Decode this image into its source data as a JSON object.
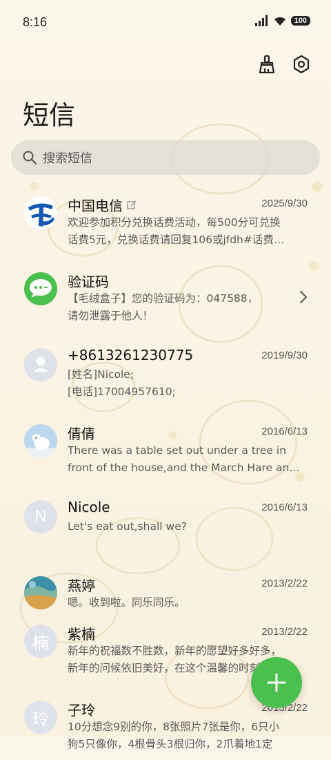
{
  "status": {
    "time": "8:16",
    "battery": "100"
  },
  "header": {
    "title": "短信"
  },
  "search": {
    "placeholder": "搜索短信"
  },
  "conversations": [
    {
      "name": "中国电信",
      "date": "2025/9/30",
      "line1": "欢迎参加积分兑换话费活动，每500分可兑换",
      "line2": "话费5元，兑换话费请回复106或jfdh#话费…"
    },
    {
      "name": "验证码",
      "date": "",
      "line1": "【毛绒盒子】您的验证码为：047588，",
      "line2": "请勿泄露于他人！"
    },
    {
      "name": "+8613261230775",
      "date": "2019/9/30",
      "line1": "[姓名]Nicole;",
      "line2": "[电话]17004957610;"
    },
    {
      "name": "倩倩",
      "date": "2016/6/13",
      "line1": "There was a table set out under a tree in",
      "line2": "front of the house,and the March Hare an…"
    },
    {
      "name": "Nicole",
      "date": "2016/6/13",
      "line1": "Let's eat out,shall we?",
      "line2": "",
      "letter": "N"
    },
    {
      "name": "燕婷",
      "date": "2013/2/22",
      "line1": "嗯。收到啦。同乐同乐。",
      "line2": ""
    },
    {
      "name": "紫楠",
      "date": "2013/2/22",
      "line1": "新年的祝福数不胜数，新年的愿望好多好多，",
      "line2": "新年的问候依旧美好，在这个温馨的时刻…",
      "letter": "楠"
    },
    {
      "name": "子玲",
      "date": "2013/2/22",
      "line1": "10分想念9别的你，8张照片7张是你，6只小",
      "line2": "狗5只像你，4根骨头3根归你，2爪着地1定",
      "letter": "玲"
    }
  ],
  "colors": {
    "accent": "#4cc04f",
    "telecom_blue": "#1657b3",
    "background": "#fbf6ea"
  }
}
